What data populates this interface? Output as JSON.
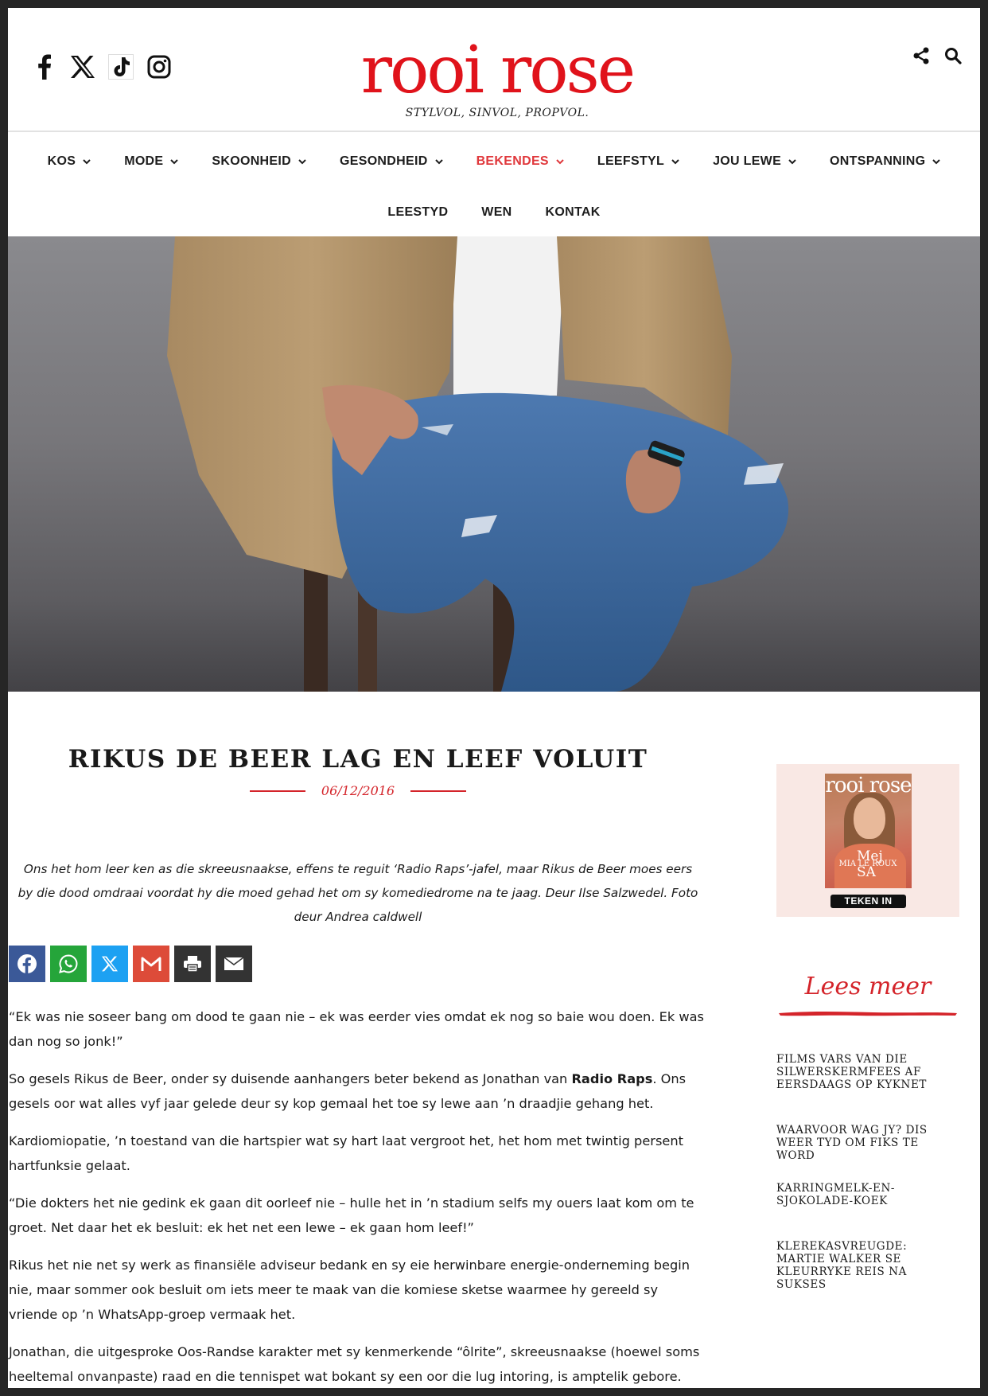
{
  "header": {
    "social": [
      "facebook-icon",
      "x-icon",
      "tiktok-icon",
      "instagram-icon"
    ],
    "logo": "rooi rose",
    "tagline": "STYLVOL, SINVOL, PROPVOL.",
    "actions": [
      "share-icon",
      "search-icon"
    ]
  },
  "nav": {
    "row1": [
      {
        "label": "KOS",
        "dropdown": true
      },
      {
        "label": "MODE",
        "dropdown": true
      },
      {
        "label": "SKOONHEID",
        "dropdown": true
      },
      {
        "label": "GESONDHEID",
        "dropdown": true
      },
      {
        "label": "BEKENDES",
        "dropdown": true,
        "active": true
      },
      {
        "label": "LEEFSTYL",
        "dropdown": true
      },
      {
        "label": "JOU LEWE",
        "dropdown": true
      },
      {
        "label": "ONTSPANNING",
        "dropdown": true
      }
    ],
    "row2": [
      {
        "label": "LEESTYD",
        "dropdown": false
      },
      {
        "label": "WEN",
        "dropdown": false
      },
      {
        "label": "KONTAK",
        "dropdown": false
      }
    ]
  },
  "article": {
    "title": "RIKUS DE BEER LAG EN LEEF VOLUIT",
    "date": "06/12/2016",
    "intro": "Ons het hom leer ken as die skreeusnaakse, effens te reguit ‘Radio Raps’-jafel, maar Rikus de Beer moes eers by die dood omdraai voordat hy die moed gehad het om sy komediedrome na te jaag. Deur Ilse Salzwedel. Foto deur Andrea caldwell",
    "share_buttons": [
      {
        "name": "facebook",
        "color": "#3b5998"
      },
      {
        "name": "whatsapp",
        "color": "#25a53a"
      },
      {
        "name": "x",
        "color": "#1da1f2"
      },
      {
        "name": "gmail",
        "color": "#dd4b39"
      },
      {
        "name": "print",
        "color": "#333333"
      },
      {
        "name": "email",
        "color": "#333333"
      }
    ],
    "p1": "“Ek was nie soseer bang om dood te gaan nie – ek was eerder vies omdat ek nog so baie wou doen. Ek was dan nog so jonk!”",
    "p2_a": "So gesels Rikus de Beer, onder sy duisende aanhangers beter bekend as Jonathan van ",
    "p2_b": "Radio Raps",
    "p2_c": ". Ons gesels oor wat alles vyf jaar gelede deur sy kop gemaal het toe sy lewe aan ’n draadjie gehang het.",
    "p3": "Kardiomiopatie, ’n toestand van die hartspier wat sy hart laat vergroot het, het hom met twintig persent hartfunksie gelaat.",
    "p4": "“Die dokters het nie gedink ek gaan dit oorleef nie – hulle het in ’n stadium selfs my ouers laat kom om te groet. Net daar het ek besluit: ek het net een lewe – ek gaan hom leef!”",
    "p5": "Rikus het nie net sy werk as finansiële adviseur bedank en sy eie herwinbare energie-onderneming begin nie, maar sommer ook besluit om iets meer te maak van die komiese sketse waarmee hy gereeld sy vriende op ’n WhatsApp-groep vermaak het.",
    "p6": "Jonathan, die uitgesproke Oos-Randse karakter met sy kenmerkende “ôlrite”, skreeusnaakse (hoewel soms heeltemal onvanpaste) raad en die tennispet wat bokant sy een oor die lug intoring, is amptelik gebore."
  },
  "sidebar": {
    "magazine": {
      "masthead": "rooi rose",
      "cover_line_1": "Mej SA",
      "cover_line_2": "MIA LE ROUX",
      "cta": "TEKEN IN"
    },
    "lees_meer": "Lees meer",
    "related": [
      "FILMS VARS VAN DIE SILWERSKERMFEES AF EERSDAAGS OP KYKNET",
      "WAARVOOR WAG JY? DIS WEER TYD OM FIKS TE WORD",
      "KARRINGMELK-EN-SJOKOLADE-KOEK",
      "KLEREKASVREUGDE: MARTIE WALKER SE KLEURRYKE REIS NA SUKSES"
    ]
  },
  "colors": {
    "brand_red": "#e0131b",
    "accent_red": "#d4242a",
    "active_nav": "#e0383c",
    "sidebar_box": "#f9e8e4"
  }
}
